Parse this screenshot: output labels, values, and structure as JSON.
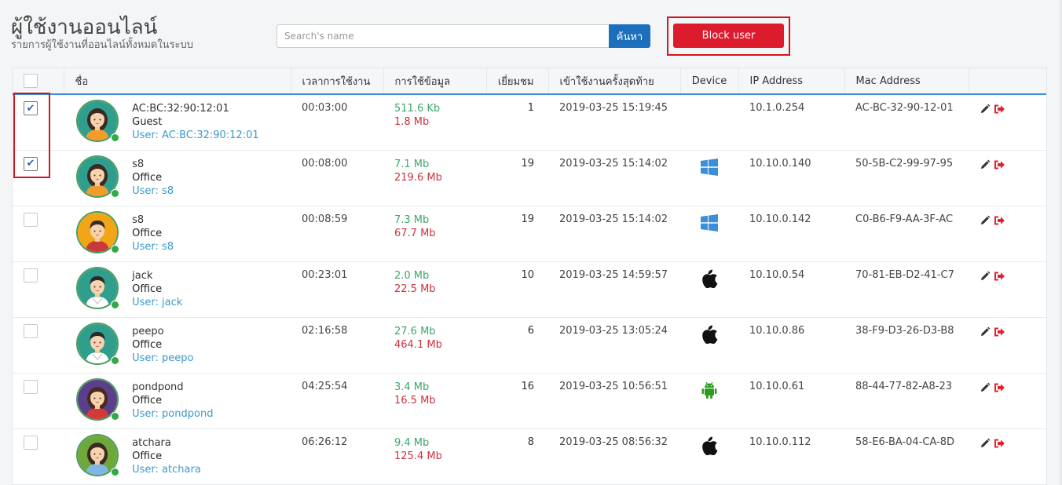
{
  "header": {
    "title": "ผู้ใช้งานออนไลน์",
    "subtitle": "รายการผู้ใช้งานที่ออนไลน์ทั้งหมดในระบบ"
  },
  "search": {
    "placeholder": "Search's name",
    "value": "",
    "button_label": "ค้นหา"
  },
  "block_button": {
    "label": "Block user"
  },
  "table": {
    "columns": {
      "name": "ชื่อ",
      "duration": "เวลาการใช้งาน",
      "data_usage": "การใช้ข้อมูล",
      "visits": "เยี่ยมชม",
      "last_login": "เข้าใช้งานครั้งสุดท้าย",
      "device": "Device",
      "ip": "IP Address",
      "mac": "Mac Address"
    },
    "rows": [
      {
        "checked": true,
        "avatar": "woman-teal",
        "name": "AC:BC:32:90:12:01",
        "group": "Guest",
        "login": "User: AC:BC:32:90:12:01",
        "duration": "00:03:00",
        "download": "511.6 Kb",
        "upload": "1.8 Mb",
        "visits": "1",
        "last_login": "2019-03-25 15:19:45",
        "device": "",
        "ip": "10.1.0.254",
        "mac": "AC-BC-32-90-12-01"
      },
      {
        "checked": true,
        "avatar": "woman-teal",
        "name": "s8",
        "group": "Office",
        "login": "User: s8",
        "duration": "00:08:00",
        "download": "7.1 Mb",
        "upload": "219.6 Mb",
        "visits": "19",
        "last_login": "2019-03-25 15:14:02",
        "device": "windows",
        "ip": "10.10.0.140",
        "mac": "50-5B-C2-99-97-95"
      },
      {
        "checked": false,
        "avatar": "man-orange",
        "name": "s8",
        "group": "Office",
        "login": "User: s8",
        "duration": "00:08:59",
        "download": "7.3 Mb",
        "upload": "67.7 Mb",
        "visits": "19",
        "last_login": "2019-03-25 15:14:02",
        "device": "windows",
        "ip": "10.10.0.142",
        "mac": "C0-B6-F9-AA-3F-AC"
      },
      {
        "checked": false,
        "avatar": "man-teal",
        "name": "jack",
        "group": "Office",
        "login": "User: jack",
        "duration": "00:23:01",
        "download": "2.0 Mb",
        "upload": "22.5 Mb",
        "visits": "10",
        "last_login": "2019-03-25 14:59:57",
        "device": "apple",
        "ip": "10.10.0.54",
        "mac": "70-81-EB-D2-41-C7"
      },
      {
        "checked": false,
        "avatar": "man-teal",
        "name": "peepo",
        "group": "Office",
        "login": "User: peepo",
        "duration": "02:16:58",
        "download": "27.6 Mb",
        "upload": "464.1 Mb",
        "visits": "6",
        "last_login": "2019-03-25 13:05:24",
        "device": "apple",
        "ip": "10.10.0.86",
        "mac": "38-F9-D3-26-D3-B8"
      },
      {
        "checked": false,
        "avatar": "woman-purple",
        "name": "pondpond",
        "group": "Office",
        "login": "User: pondpond",
        "duration": "04:25:54",
        "download": "3.4 Mb",
        "upload": "16.5 Mb",
        "visits": "16",
        "last_login": "2019-03-25 10:56:51",
        "device": "android",
        "ip": "10.10.0.61",
        "mac": "88-44-77-82-A8-23"
      },
      {
        "checked": false,
        "avatar": "woman-green",
        "name": "atchara",
        "group": "Office",
        "login": "User: atchara",
        "duration": "06:26:12",
        "download": "9.4 Mb",
        "upload": "125.4 Mb",
        "visits": "8",
        "last_login": "2019-03-25 08:56:32",
        "device": "apple",
        "ip": "10.10.0.112",
        "mac": "58-E6-BA-04-CA-8D"
      }
    ]
  },
  "colors": {
    "primary": "#1b6fbd",
    "danger": "#dc1b2c",
    "download": "#3aa76d",
    "upload": "#c9343c",
    "login": "#3a9ac9",
    "online": "#2faa47",
    "windows": "#3b8ed8",
    "android": "#2e9a1e"
  }
}
